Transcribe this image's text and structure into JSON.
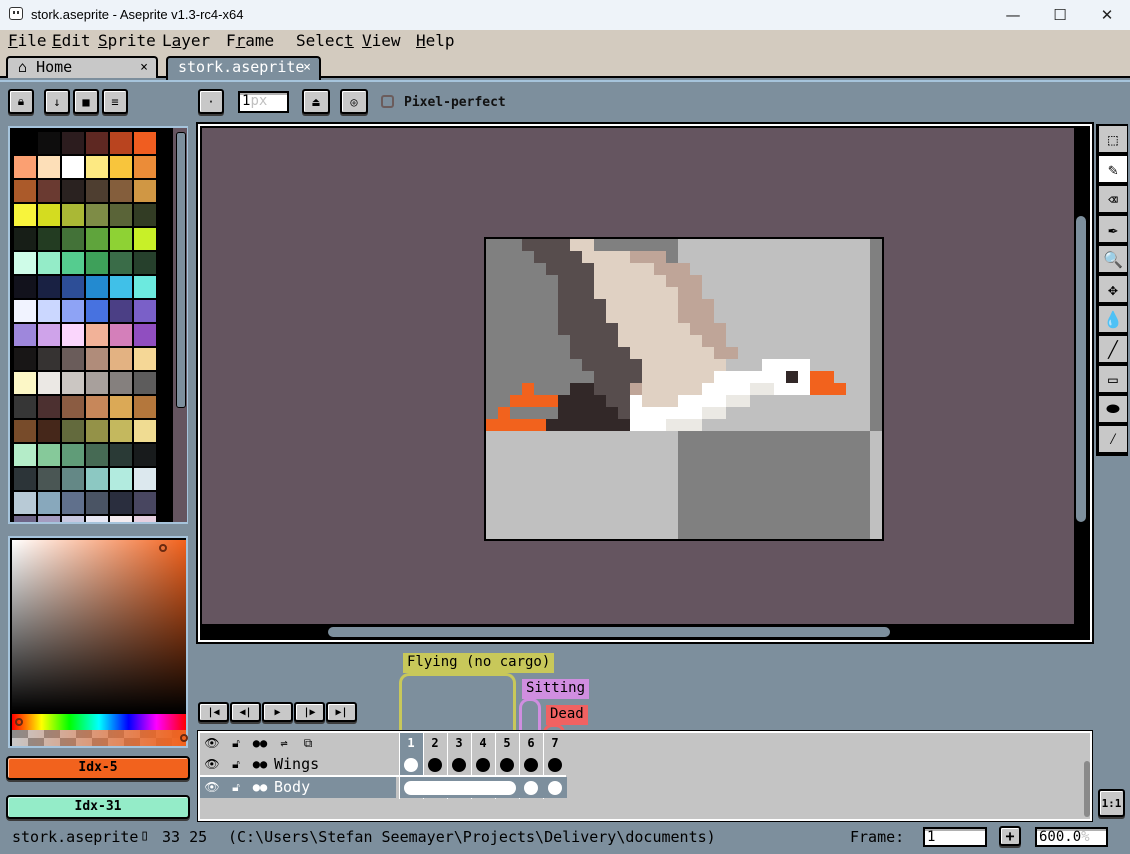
{
  "window": {
    "title": "stork.aseprite - Aseprite v1.3-rc4-x64",
    "minimize_icon": "minimize-icon",
    "maximize_icon": "maximize-icon",
    "close_icon": "close-icon"
  },
  "menu": [
    {
      "label": "File",
      "u": "F",
      "rest": "ile"
    },
    {
      "label": "Edit",
      "u": "E",
      "rest": "dit"
    },
    {
      "label": "Sprite",
      "u": "S",
      "rest": "prite"
    },
    {
      "label": "Layer",
      "pre": "L",
      "u": "a",
      "rest": "yer"
    },
    {
      "label": "Frame",
      "pre": "F",
      "u": "r",
      "rest": "ame"
    },
    {
      "label": "Select",
      "pre": "Selec",
      "u": "t",
      "rest": ""
    },
    {
      "label": "View",
      "u": "V",
      "rest": "iew"
    },
    {
      "label": "Help",
      "u": "H",
      "rest": "elp"
    }
  ],
  "tabs": [
    {
      "label": "Home",
      "icon": "home-icon",
      "close": "×",
      "active": false
    },
    {
      "label": "stork.aseprite",
      "close": "×",
      "active": true
    }
  ],
  "toolbar": {
    "brush_size": "1",
    "brush_unit": "px",
    "pixel_perfect_label": "Pixel-perfect",
    "pixel_perfect_checked": false
  },
  "palette": {
    "selected_fg_index": 5,
    "rows": [
      [
        "#000000",
        "#0e0d0d",
        "#2c1c1e",
        "#5e2822",
        "#b9441f",
        "#f05d20"
      ],
      [
        "#fba072",
        "#fddfb8",
        "#ffffff",
        "#fde982",
        "#f8c53c",
        "#eb8c38"
      ],
      [
        "#ab5a2a",
        "#6a3a31",
        "#2a2220",
        "#4e3e30",
        "#845e3c",
        "#d09744"
      ],
      [
        "#f8f43c",
        "#d4dc20",
        "#aab835",
        "#7e8c46",
        "#5a6438",
        "#323c24"
      ],
      [
        "#171e17",
        "#233c22",
        "#437238",
        "#5fa43c",
        "#8ed234",
        "#c8f028"
      ],
      [
        "#cffce8",
        "#94ecc8",
        "#55cc8f",
        "#3ea05a",
        "#3a6c48",
        "#26402c"
      ],
      [
        "#12121c",
        "#192143",
        "#2d4e97",
        "#238ad0",
        "#40c0e8",
        "#6ceadf"
      ],
      [
        "#f1f3ff",
        "#cbd7ff",
        "#8ea3f5",
        "#4772e0",
        "#4b3f85",
        "#7a60c8"
      ],
      [
        "#9e87dc",
        "#cfa3ea",
        "#fad6fc",
        "#f2b298",
        "#d47fba",
        "#904ec0"
      ],
      [
        "#181616",
        "#363332",
        "#6a5c5a",
        "#b08c7a",
        "#e3b282",
        "#f5d796"
      ],
      [
        "#fcf7c6",
        "#ebe8e4",
        "#cbc6c2",
        "#a8a09c",
        "#85807e",
        "#5d5c5c"
      ],
      [
        "#363636",
        "#4c3030",
        "#8b5c42",
        "#c7875a",
        "#dba956",
        "#b4773c"
      ],
      [
        "#774b2a",
        "#45271a",
        "#636a3d",
        "#949248",
        "#c4b85e",
        "#f0dc92"
      ],
      [
        "#b4ecc8",
        "#86c99a",
        "#609c78",
        "#466a54",
        "#2a3a36",
        "#181b1c"
      ],
      [
        "#2c3438",
        "#4a5654",
        "#648886",
        "#8cc8c2",
        "#b2ebdf",
        "#dce8ee"
      ],
      [
        "#b8cad6",
        "#88a8bc",
        "#60708c",
        "#4a5464",
        "#2a2e3e",
        "#484660"
      ],
      [
        "#6e6588",
        "#a49cc0",
        "#c8c8e0",
        "#e8e8f4",
        "#f4ecf0",
        "#e6d0e0"
      ]
    ]
  },
  "color_picker": {
    "hue_color": "#f2621d"
  },
  "foreground": {
    "label": "Idx-5",
    "color": "#f2621d"
  },
  "background": {
    "label": "Idx-31",
    "color": "#94ecc8"
  },
  "tools": [
    {
      "name": "rectangular-marquee-icon",
      "glyph": "⬚",
      "active": false
    },
    {
      "name": "pencil-icon",
      "glyph": "✎",
      "active": true
    },
    {
      "name": "eraser-icon",
      "glyph": "⌫",
      "active": false
    },
    {
      "name": "eyedropper-icon",
      "glyph": "✒",
      "active": false
    },
    {
      "name": "zoom-icon",
      "glyph": "🔍",
      "active": false
    },
    {
      "name": "move-icon",
      "glyph": "✥",
      "active": false
    },
    {
      "name": "paint-bucket-icon",
      "glyph": "💧",
      "active": false
    },
    {
      "name": "line-icon",
      "glyph": "╱",
      "active": false
    },
    {
      "name": "rectangle-icon",
      "glyph": "▭",
      "active": false
    },
    {
      "name": "contour-icon",
      "glyph": "⬬",
      "active": false
    },
    {
      "name": "blur-icon",
      "glyph": "⁄",
      "active": false
    }
  ],
  "sprite": {
    "width": 33,
    "height": 25,
    "colors": {
      "G": "#808080",
      "L": "#c0c0c0",
      "D": "#574d4d",
      "C": "#e0d1c3",
      "T": "#bfa598",
      "W": "#ffffff",
      "O": "#f2621d",
      "K": "#322828",
      "E": "#ebe9e4",
      "Y": "#322828"
    },
    "rows": [
      "GGGDDDDCCGGGGGGGLLLLLLLLLLLLLLLLG",
      "GGGGDDDDCCCCTTTGLLLLLLLLLLLLLLLLG",
      "GGGGGDDDDCCCCCTTTLLLLLLLLLLLLLLLG",
      "GGGGGGDDDCCCCCCTTTLLLLLLLLLLLLLLG",
      "GGGGGGDDDCCCCCCCTTLLLLLLLLLLLLLLG",
      "GGGGGGDDDDCCCCCCTTTLLLLLLLLLLLLLG",
      "GGGGGGDDDDCCCCCCTTTLLLLLLLLLLLLLG",
      "GGGGGGDDDDDCCCCCCTTTLLLLLLLLLLLLG",
      "GGGGGGGDDDDCCCCCCCTTLLLLLLLLLLLLG",
      "GGGGGGGDDDDDCCCCCCCTTLLLLLLLLLLLG",
      "GGGGGGGGDDDDDCCCCCCCLLLWWWWLLLLLG",
      "GGGGGGGGGDDDDCCCCCCWWWWWWYWOOLLLG",
      "GGGOGGGKKDDDTCCCCCWWWWEEWWWOOOLLG",
      "GGOOOOKKKKDDWCCCWWWWEELLLLLLLLLLG",
      "GOGGGGKKKKKDWWWWWWEELLLLLLLLLLLLG",
      "OOOOOKKKKKKKWWWEEELLLLLLLLLLLLLLG",
      "LLLLLLLLLLLLLLLLGGGGGGGGGGGGGGGGL",
      "LLLLLLLLLLLLLLLLGGGGGGGGGGGGGGGGL",
      "LLLLLLLLLLLLLLLLGGGGGGGGGGGGGGGGL",
      "LLLLLLLLLLLLLLLLGGGGGGGGGGGGGGGGL",
      "LLLLLLLLLLLLLLLLGGGGGGGGGGGGGGGGL",
      "LLLLLLLLLLLLLLLLGGGGGGGGGGGGGGGGL",
      "LLLLLLLLLLLLLLLLGGGGGGGGGGGGGGGGL",
      "LLLLLLLLLLLLLLLLGGGGGGGGGGGGGGGGL",
      "LLLLLLLLLLLLLLLLGGGGGGGGGGGGGGGGL"
    ]
  },
  "timeline": {
    "playback": [
      {
        "name": "first-frame-button",
        "glyph": "⏮"
      },
      {
        "name": "previous-frame-button",
        "glyph": "◀"
      },
      {
        "name": "play-button",
        "glyph": "▶"
      },
      {
        "name": "next-frame-button",
        "glyph": "▶"
      },
      {
        "name": "last-frame-button",
        "glyph": "⏭"
      }
    ],
    "tags": [
      {
        "label": "Flying (no cargo)",
        "color": "#c8c85a",
        "from": 1,
        "to": 5
      },
      {
        "label": "Sitting",
        "color": "#d08ee0",
        "from": 6,
        "to": 6
      },
      {
        "label": "Dead",
        "color": "#f06262",
        "from": 7,
        "to": 7
      }
    ],
    "frames": [
      "1",
      "2",
      "3",
      "4",
      "5",
      "6",
      "7"
    ],
    "current_frame": 1,
    "layers": [
      {
        "name": "Wings",
        "visible": true,
        "locked": false,
        "cels": [
          "empty-selected",
          "filled",
          "filled",
          "filled",
          "filled",
          "filled",
          "filled"
        ]
      },
      {
        "name": "Body",
        "visible": true,
        "locked": false,
        "selected": true,
        "cels": [
          "linked-1-5",
          "linked-1-5",
          "linked-1-5",
          "linked-1-5",
          "linked-1-5",
          "empty",
          "empty"
        ]
      }
    ]
  },
  "statusbar": {
    "filename": "stork.aseprite",
    "size": "33 25",
    "path": "(C:\\Users\\Stefan Seemayer\\Projects\\Delivery\\documents)",
    "frame_label": "Frame:",
    "frame_value": "1",
    "zoom_value": "600.0",
    "zoom_unit": "%",
    "zoom_reset_label": "1:1",
    "add_frame_label": "+"
  }
}
